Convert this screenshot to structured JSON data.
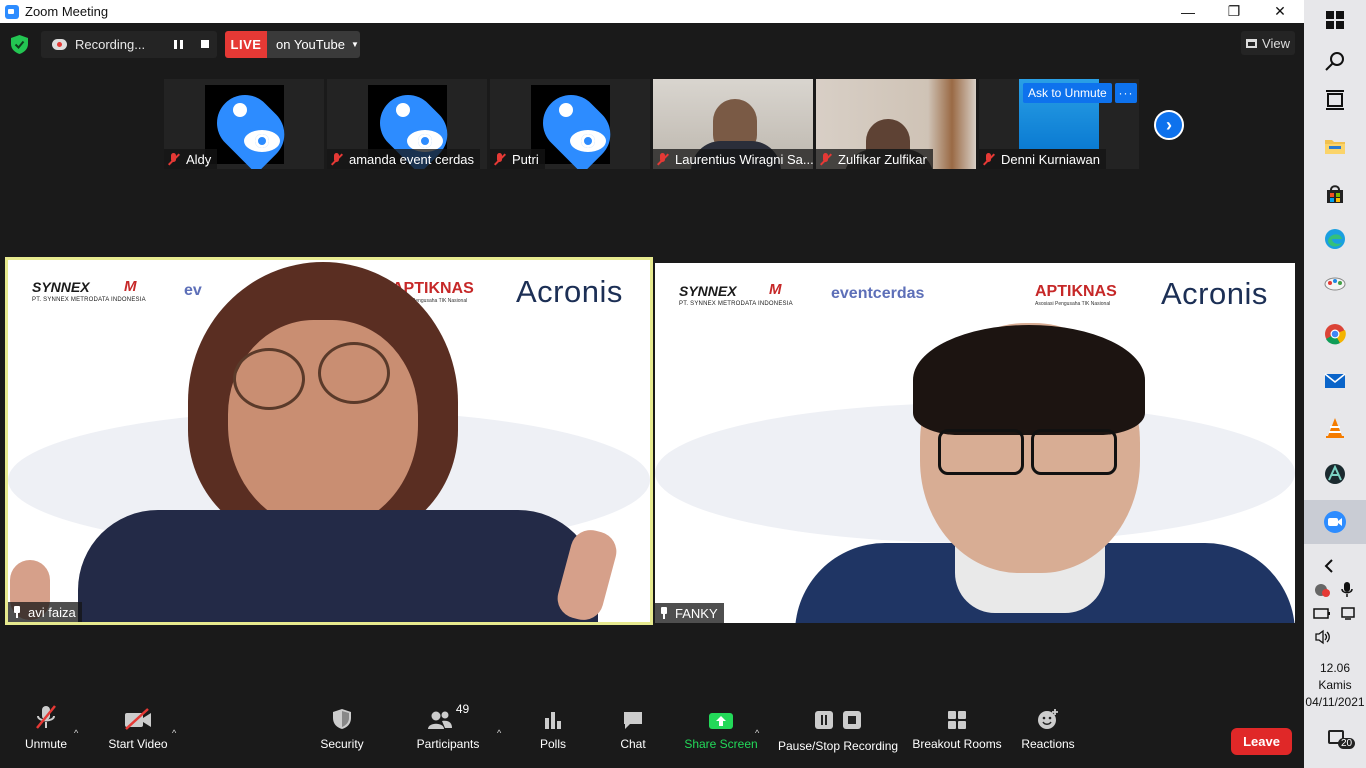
{
  "window": {
    "title": "Zoom Meeting",
    "minimize": "—",
    "restore": "❐",
    "close": "✕"
  },
  "recording": {
    "label": "Recording...",
    "live_label": "LIVE",
    "live_target": "on YouTube"
  },
  "view_button": "View",
  "ask_to_unmute": "Ask to Unmute",
  "more_button": "···",
  "thumbnails": [
    {
      "name": "Aldy",
      "video": false
    },
    {
      "name": "amanda event cerdas",
      "video": false
    },
    {
      "name": "Putri",
      "video": false
    },
    {
      "name": "Laurentius Wiragni Sa...",
      "video": true
    },
    {
      "name": "Zulfikar Zulfikar",
      "video": true
    },
    {
      "name": "Denni Kurniawan",
      "video": true
    }
  ],
  "main_videos": [
    {
      "name": "avi faiza",
      "active": true
    },
    {
      "name": "FANKY",
      "active": false
    }
  ],
  "banner": {
    "synnex": "SYNNEX",
    "synnex_sub": "PT. SYNNEX METRODATA INDONESIA",
    "metrodata": "M",
    "eventcerdas": "eventcerdas",
    "eventcerdas_cut": "ev",
    "aptiknas": "APTIKNAS",
    "aptiknas_sub": "Asosiasi Pengusaha TIK Nasional",
    "acronis": "Acronis"
  },
  "toolbar": {
    "unmute": "Unmute",
    "start_video": "Start Video",
    "security": "Security",
    "participants": "Participants",
    "participants_count": "49",
    "polls": "Polls",
    "chat": "Chat",
    "share_screen": "Share Screen",
    "pause_stop_recording": "Pause/Stop Recording",
    "breakout_rooms": "Breakout Rooms",
    "reactions": "Reactions",
    "leave": "Leave"
  },
  "taskbar": {
    "time": "12.06",
    "day": "Kamis",
    "date": "04/11/2021",
    "notification_count": "20"
  },
  "colors": {
    "zoom_blue": "#0e72ed",
    "live_red": "#e53935",
    "leave_red": "#e02828",
    "share_green": "#23d959",
    "active_speaker": "#e7ea8f"
  }
}
